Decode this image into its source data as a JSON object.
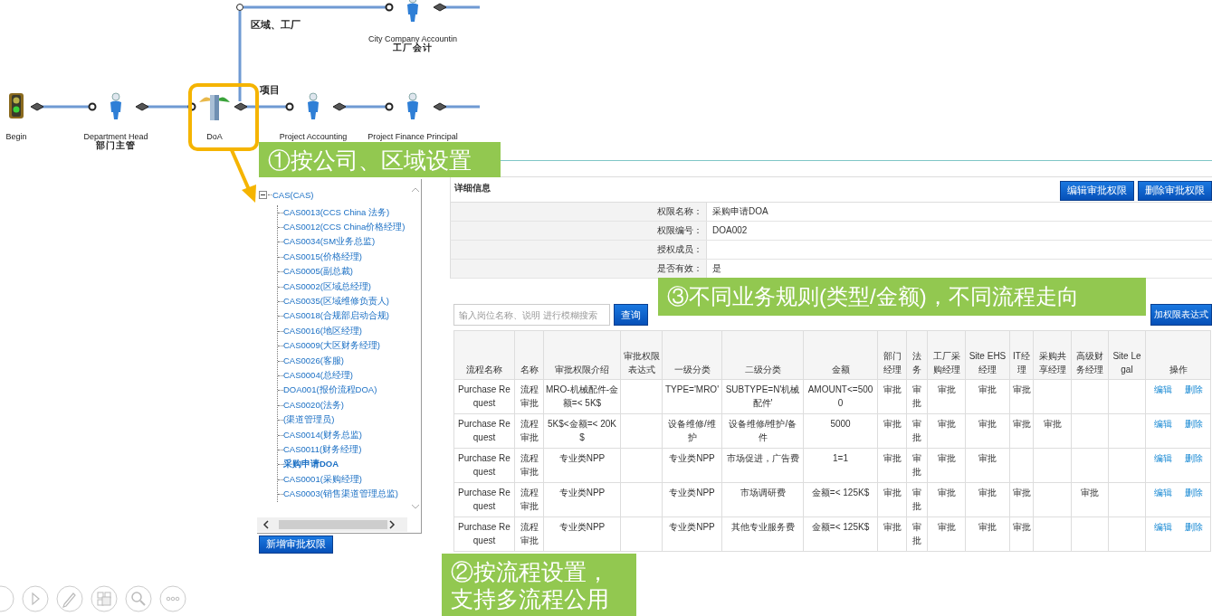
{
  "workflow": {
    "branch_labels": [
      "区域、工厂",
      "项目"
    ],
    "nodes": [
      {
        "kind": "person",
        "label": "City Company Accountin",
        "sublabel": "工厂会计",
        "highlighted": false
      },
      {
        "kind": "start",
        "label": "Begin",
        "highlighted": false
      },
      {
        "kind": "person",
        "label": "Department Head",
        "sublabel": "部门主管",
        "highlighted": false
      },
      {
        "kind": "doa",
        "label": "DoA",
        "highlighted": true
      },
      {
        "kind": "person",
        "label": "Project Accounting",
        "highlighted": false
      },
      {
        "kind": "person",
        "label": "Project Finance Principal",
        "highlighted": false
      }
    ]
  },
  "callouts": [
    {
      "lines": [
        "①按公司、区域设置"
      ]
    },
    {
      "lines": [
        "②按流程设置，",
        "支持多流程公用"
      ]
    },
    {
      "lines": [
        "③不同业务规则(类型/金额)，不同流程走向"
      ]
    }
  ],
  "tree": {
    "root": {
      "label": "CAS(CAS)",
      "expanded": true,
      "children": [
        {
          "label": "CAS0013(CCS China 法务)",
          "selected": false
        },
        {
          "label": "CAS0012(CCS China价格经理)",
          "selected": false
        },
        {
          "label": "CAS0034(SM业务总监)",
          "selected": false
        },
        {
          "label": "CAS0015(价格经理)",
          "selected": false
        },
        {
          "label": "CAS0005(副总裁)",
          "selected": false
        },
        {
          "label": "CAS0002(区域总经理)",
          "selected": false
        },
        {
          "label": "CAS0035(区域维修负责人)",
          "selected": false
        },
        {
          "label": "CAS0018(合规部启动合规)",
          "selected": false
        },
        {
          "label": "CAS0016(地区经理)",
          "selected": false
        },
        {
          "label": "CAS0009(大区财务经理)",
          "selected": false
        },
        {
          "label": "CAS0026(客服)",
          "selected": false
        },
        {
          "label": "CAS0004(总经理)",
          "selected": false
        },
        {
          "label": "DOA001(报价流程DOA)",
          "selected": false
        },
        {
          "label": "CAS0020(法务)",
          "selected": false
        },
        {
          "label": "(渠道管理员)",
          "selected": false
        },
        {
          "label": "CAS0014(财务总监)",
          "selected": false
        },
        {
          "label": "CAS0011(财务经理)",
          "selected": false
        },
        {
          "label": "采购申请DOA",
          "selected": true
        },
        {
          "label": "CAS0001(采购经理)",
          "selected": false
        },
        {
          "label": "CAS0003(销售渠道管理总监)",
          "selected": false
        }
      ]
    }
  },
  "tree_button": "新增审批权限",
  "detail": {
    "title": "详细信息",
    "buttons": [
      "编辑审批权限",
      "删除审批权限"
    ],
    "fields": [
      {
        "label": "权限名称：",
        "value": "采购申请DOA"
      },
      {
        "label": "权限编号：",
        "value": "DOA002"
      },
      {
        "label": "授权成员："
      },
      {
        "label": "是否有效：",
        "value": "是"
      }
    ]
  },
  "search": {
    "placeholder": "输入岗位名称、说明 进行模糊搜索",
    "button": "查询",
    "add_button": "加权限表达式"
  },
  "table": {
    "columns": [
      "流程名称",
      "名称",
      "审批权限介绍",
      "审批权限表达式",
      "一级分类",
      "二级分类",
      "金额",
      "部门经理",
      "法务",
      "工厂采购经理",
      "Site EHS经理",
      "IT经理",
      "采购共享经理",
      "高级财务经理",
      "Site Legal",
      "操作"
    ],
    "rows": [
      {
        "cells": [
          "Purchase Request",
          "流程审批",
          "MRO-机械配件-金额=< 5K$",
          null,
          "TYPE='MRO'",
          "SUBTYPE=N'机械配件'",
          "AMOUNT<=5000",
          "审批",
          "审批",
          "审批",
          "审批",
          "审批",
          null,
          null,
          null
        ],
        "actions": [
          "编辑",
          "删除"
        ]
      },
      {
        "cells": [
          "Purchase Request",
          "流程审批",
          "5K$<金额=< 20K$",
          null,
          "设备维修/维护",
          "设备维修/维护/备件",
          "5000",
          "审批",
          "审批",
          "审批",
          "审批",
          "审批",
          "审批",
          null,
          null
        ],
        "actions": [
          "编辑",
          "删除"
        ]
      },
      {
        "cells": [
          "Purchase Request",
          "流程审批",
          "专业类NPP",
          null,
          "专业类NPP",
          "市场促进，广告费",
          "1=1",
          "审批",
          "审批",
          "审批",
          "审批",
          null,
          null,
          null,
          null
        ],
        "actions": [
          "编辑",
          "删除"
        ]
      },
      {
        "cells": [
          "Purchase Request",
          "流程审批",
          "专业类NPP",
          null,
          "专业类NPP",
          "市场调研费",
          "金额=< 125K$",
          "审批",
          "审批",
          "审批",
          "审批",
          "审批",
          null,
          "审批",
          null
        ],
        "actions": [
          "编辑",
          "删除"
        ]
      },
      {
        "cells": [
          "Purchase Request",
          "流程审批",
          "专业类NPP",
          null,
          "专业类NPP",
          "其他专业服务费",
          "金额=< 125K$",
          "审批",
          "审批",
          "审批",
          "审批",
          "审批",
          null,
          null,
          null
        ],
        "actions": [
          "编辑",
          "删除"
        ]
      }
    ]
  }
}
